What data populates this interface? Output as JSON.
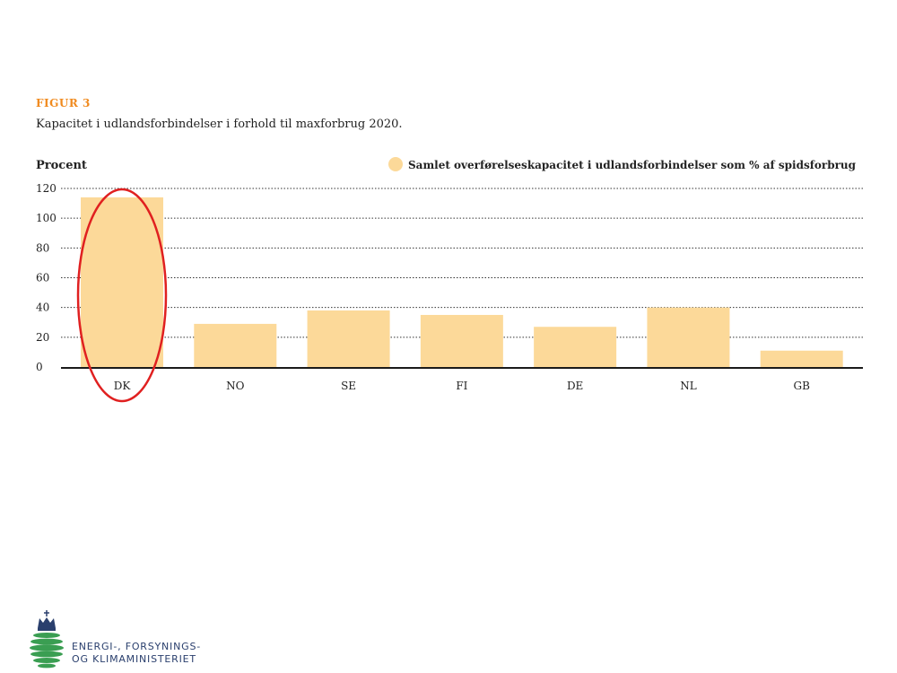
{
  "figure": {
    "label": "FIGUR 3",
    "caption": "Kapacitet i udlandsforbindelser i forhold til maxforbrug 2020."
  },
  "chart_data": {
    "type": "bar",
    "title": "",
    "ylabel": "Procent",
    "xlabel": "",
    "ylim": [
      0,
      120
    ],
    "yticks": [
      0,
      20,
      40,
      60,
      80,
      100,
      120
    ],
    "grid": true,
    "legend_position": "top-right",
    "categories": [
      "DK",
      "NO",
      "SE",
      "FI",
      "DE",
      "NL",
      "GB"
    ],
    "series": [
      {
        "name": "Samlet overførelseskapacitet i udlandsforbindelser som % af spidsforbrug",
        "values": [
          114,
          29,
          38,
          35,
          27,
          40,
          11
        ],
        "color": "#fcd999"
      }
    ],
    "annotations": [
      {
        "type": "ellipse-highlight",
        "category": "DK",
        "color": "#e02020"
      }
    ]
  },
  "logo": {
    "line1": "ENERGI-, FORSYNINGS-",
    "line2": "OG KLIMAMINISTERIET",
    "colors": {
      "green": "#3a9e52",
      "navy": "#2a3f6d"
    }
  }
}
